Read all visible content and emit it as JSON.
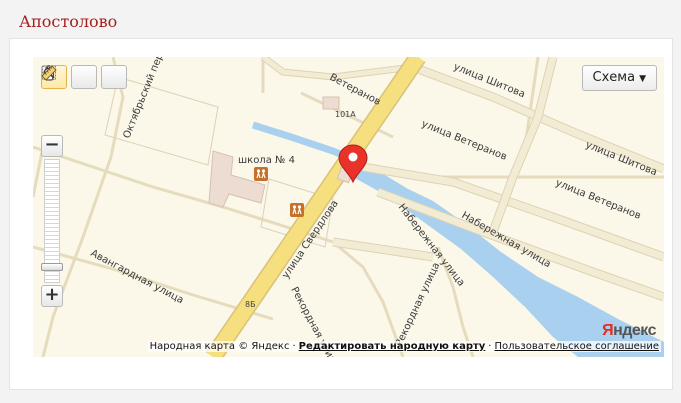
{
  "page": {
    "title": "Апостолово"
  },
  "map": {
    "layer_button": "Схема",
    "tools": [
      {
        "name": "drag-tool",
        "icon": "hand-icon",
        "active": true
      },
      {
        "name": "magnifier-tool",
        "icon": "magnifier-icon",
        "active": false
      },
      {
        "name": "ruler-tool",
        "icon": "ruler-icon",
        "active": false
      }
    ],
    "zoom": {
      "in_label": "+",
      "out_label": "−",
      "level": 0.1
    },
    "streets": {
      "oktyabrsky": "Октябрьский пер.",
      "veteranov_top": "Ветеранов",
      "shitova_top": "улица Шитова",
      "veteranov_mid": "улица Ветеранов",
      "shitova_right": "улица Шитова",
      "veteranov_right": "улица Ветеранов",
      "naberezhnaya_long": "Набережная улица",
      "naberezhnaya_short": "Набережная улица",
      "sverdlova": "улица Свердлова",
      "avangardnaya": "Авангардная улица",
      "rekordnaya": "Рекордная улица",
      "rekordnaya_right": "Рекордная улица"
    },
    "pois": {
      "school": "школа № 4"
    },
    "house_numbers": {
      "h101a": "101А",
      "h8b": "8Б"
    },
    "logo": {
      "ya": "Я",
      "rest": "ндекс"
    },
    "copyright": {
      "text": "Народная карта © Яндекс",
      "edit_link": "Редактировать народную карту",
      "terms_link": "Пользовательское соглашение",
      "separator": "·"
    },
    "colors": {
      "background": "#fbf7e9",
      "road": "#f6df7e",
      "road_outline": "#ded2b3",
      "minor_road": "#ece5cc",
      "water": "#a9d0ee",
      "building": "#eddcd2",
      "marker": "#e8322a"
    }
  }
}
